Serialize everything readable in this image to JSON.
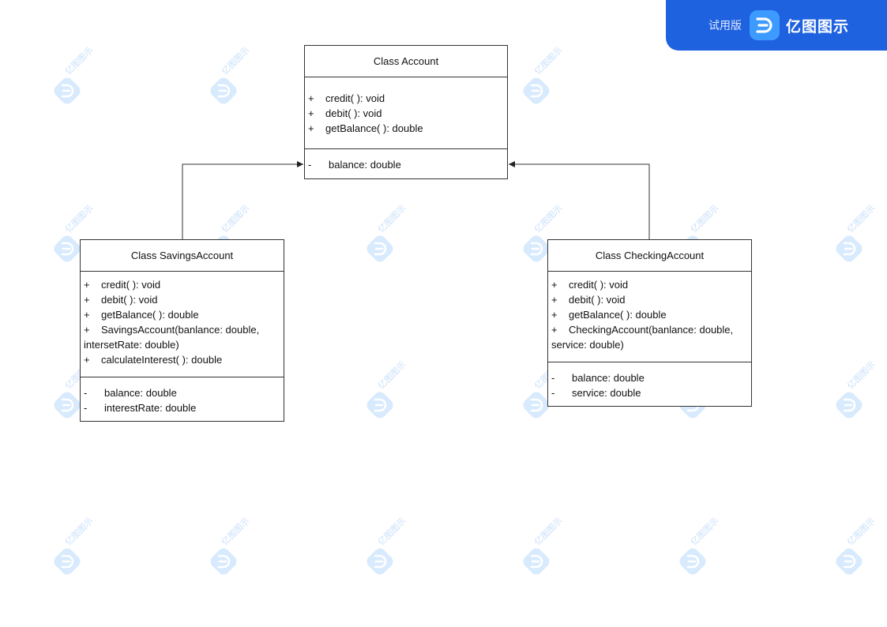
{
  "banner": {
    "trial_label": "试用版",
    "brand_name": "亿图图示",
    "logo_icon": "edraw-logo-icon",
    "color": "#1f62e0"
  },
  "watermark": {
    "text": "亿图图示",
    "icon": "edraw-logo-icon",
    "color": "#9cc6f5"
  },
  "classes": {
    "account": {
      "title": "Class Account",
      "methods": [
        {
          "vis": "+",
          "text": "credit( ): void"
        },
        {
          "vis": "+",
          "text": "debit( ): void"
        },
        {
          "vis": "+",
          "text": "getBalance( ): double"
        }
      ],
      "attributes": [
        {
          "vis": "-",
          "text": "balance: double"
        }
      ]
    },
    "savings": {
      "title": "Class SavingsAccount",
      "methods": [
        {
          "vis": "+",
          "text": "credit( ): void"
        },
        {
          "vis": "+",
          "text": "debit( ): void"
        },
        {
          "vis": "+",
          "text": "getBalance( ): double"
        },
        {
          "vis": "+",
          "text": "SavingsAccount(banlance: double,"
        },
        {
          "vis": "",
          "text": "intersetRate: double)"
        },
        {
          "vis": "+",
          "text": "calculateInterest( ): double"
        }
      ],
      "attributes": [
        {
          "vis": "-",
          "text": "balance: double"
        },
        {
          "vis": "-",
          "text": "interestRate: double"
        }
      ]
    },
    "checking": {
      "title": "Class CheckingAccount",
      "methods": [
        {
          "vis": "+",
          "text": "credit( ): void"
        },
        {
          "vis": "+",
          "text": "debit( ): void"
        },
        {
          "vis": "+",
          "text": "getBalance( ): double"
        },
        {
          "vis": "+",
          "text": "CheckingAccount(banlance: double,"
        },
        {
          "vis": "",
          "text": "service: double)"
        }
      ],
      "attributes": [
        {
          "vis": "-",
          "text": "balance: double"
        },
        {
          "vis": "-",
          "text": "service: double"
        }
      ]
    }
  }
}
